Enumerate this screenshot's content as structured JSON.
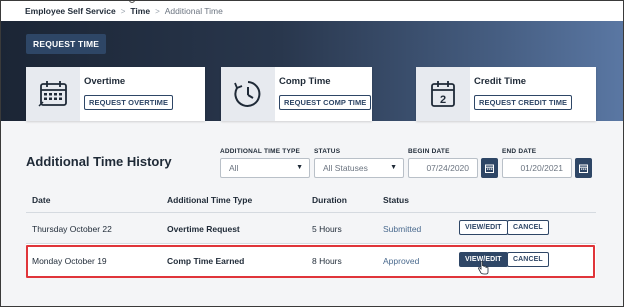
{
  "breadcrumb": {
    "root": "Employee Self Service",
    "section": "Time",
    "current": "Additional Time",
    "separator": ">"
  },
  "header": {
    "request_time_label": "REQUEST TIME"
  },
  "cards": [
    {
      "title": "Overtime",
      "button": "REQUEST OVERTIME",
      "icon": "calendar-grid-icon"
    },
    {
      "title": "Comp Time",
      "button": "REQUEST COMP TIME",
      "icon": "clock-icon"
    },
    {
      "title": "Credit Time",
      "button": "REQUEST CREDIT TIME",
      "icon": "calendar-2-icon"
    }
  ],
  "history": {
    "title": "Additional Time History",
    "filters": {
      "type_label": "ADDITIONAL TIME TYPE",
      "type_value": "All",
      "status_label": "STATUS",
      "status_value": "All Statuses",
      "begin_label": "BEGIN DATE",
      "begin_value": "07/24/2020",
      "end_label": "END DATE",
      "end_value": "01/20/2021"
    },
    "columns": [
      "Date",
      "Additional Time Type",
      "Duration",
      "Status"
    ],
    "rows": [
      {
        "date": "Thursday October 22",
        "type": "Overtime Request",
        "duration": "5 Hours",
        "status": "Submitted",
        "edit": "VIEW/EDIT",
        "cancel": "CANCEL"
      },
      {
        "date": "Monday October 19",
        "type": "Comp Time Earned",
        "duration": "8 Hours",
        "status": "Approved",
        "edit": "VIEW/EDIT",
        "cancel": "CANCEL"
      }
    ]
  },
  "colors": {
    "accent": "#2e4666",
    "highlight": "#e0353a",
    "status_text": "#4a6a8e"
  }
}
